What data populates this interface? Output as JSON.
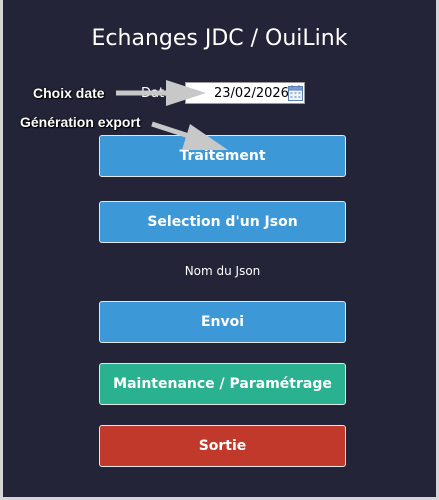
{
  "window": {
    "title": "Echanges JDC / OuiLink"
  },
  "date": {
    "label": "Date",
    "value": "23/02/2026",
    "icon": "calendar-icon"
  },
  "annotations": {
    "choix_date": "Choix date",
    "generation_export": "Génération export"
  },
  "buttons": {
    "traitement": "Traitement",
    "selection_json": "Selection d'un Json",
    "envoi": "Envoi",
    "maintenance": "Maintenance / Paramétrage",
    "sortie": "Sortie"
  },
  "json_name_label": "Nom du Json",
  "colors": {
    "background": "#242438",
    "button_blue": "#3d98d8",
    "button_green": "#2ab190",
    "button_red": "#c0392b"
  }
}
